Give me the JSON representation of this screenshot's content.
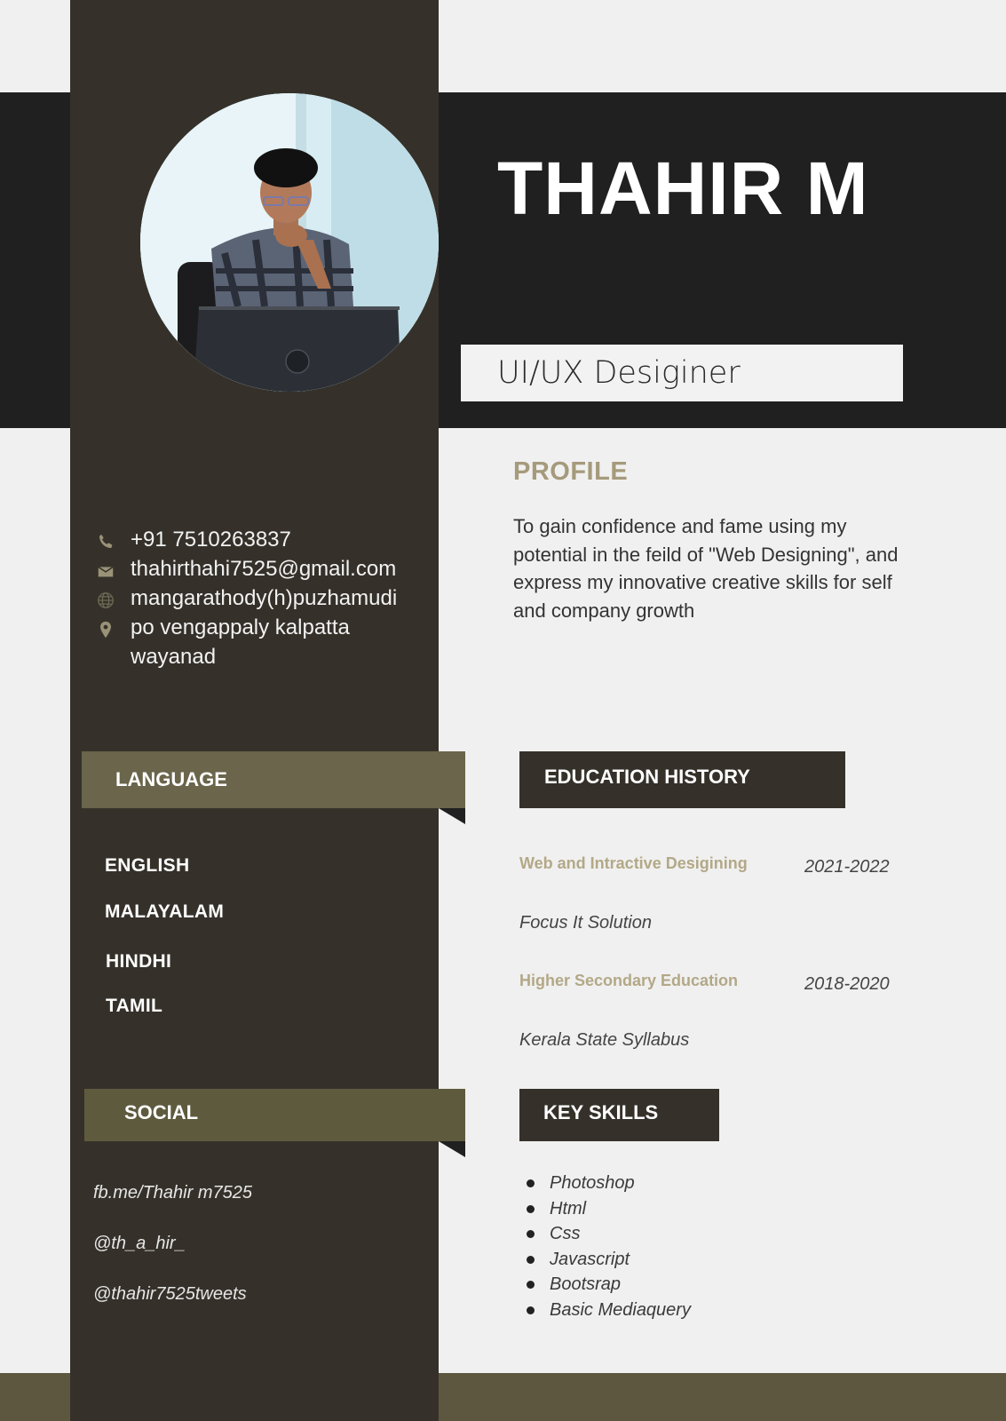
{
  "name": "THAHIR M",
  "job_title": "UI/UX Desiginer",
  "photo_icon": "profile-photo",
  "profile": {
    "heading": "PROFILE",
    "text": "To gain confidence and fame using my potential in the feild of \"Web Designing\", and express my innovative creative skills for self and company growth"
  },
  "contact": {
    "phone": "+91 7510263837",
    "email": "thahirthahi7525@gmail.com",
    "website": "mangarathody(h)puzhamudi",
    "address_line1": "po vengappaly kalpatta",
    "address_line2": "wayanad",
    "icons": [
      "phone-icon",
      "mail-icon",
      "globe-icon",
      "location-pin-icon"
    ]
  },
  "language": {
    "heading": "LANGUAGE",
    "items": [
      "ENGLISH",
      "MALAYALAM",
      "HINDHI",
      "TAMIL"
    ]
  },
  "social": {
    "heading": "SOCIAL",
    "items": [
      "fb.me/Thahir m7525",
      "@th_a_hir_",
      "@thahir7525tweets"
    ]
  },
  "education": {
    "heading": "EDUCATION HISTORY",
    "entries": [
      {
        "course": "Web and Intractive Desigining",
        "years": "2021-2022",
        "institution": "Focus It Solution"
      },
      {
        "course": "Higher Secondary Education",
        "years": "2018-2020",
        "institution": "Kerala State Syllabus"
      }
    ]
  },
  "skills": {
    "heading": "KEY SKILLS",
    "items": [
      "Photoshop",
      "Html",
      "Css",
      "Javascript",
      "Bootsrap",
      "Basic Mediaquery"
    ]
  },
  "colors": {
    "header_dark": "#202020",
    "sidebar": "#35312a",
    "accent_olive": "#6a654b",
    "accent_tan": "#a59a7b",
    "page_bg": "#f0f0f0"
  }
}
